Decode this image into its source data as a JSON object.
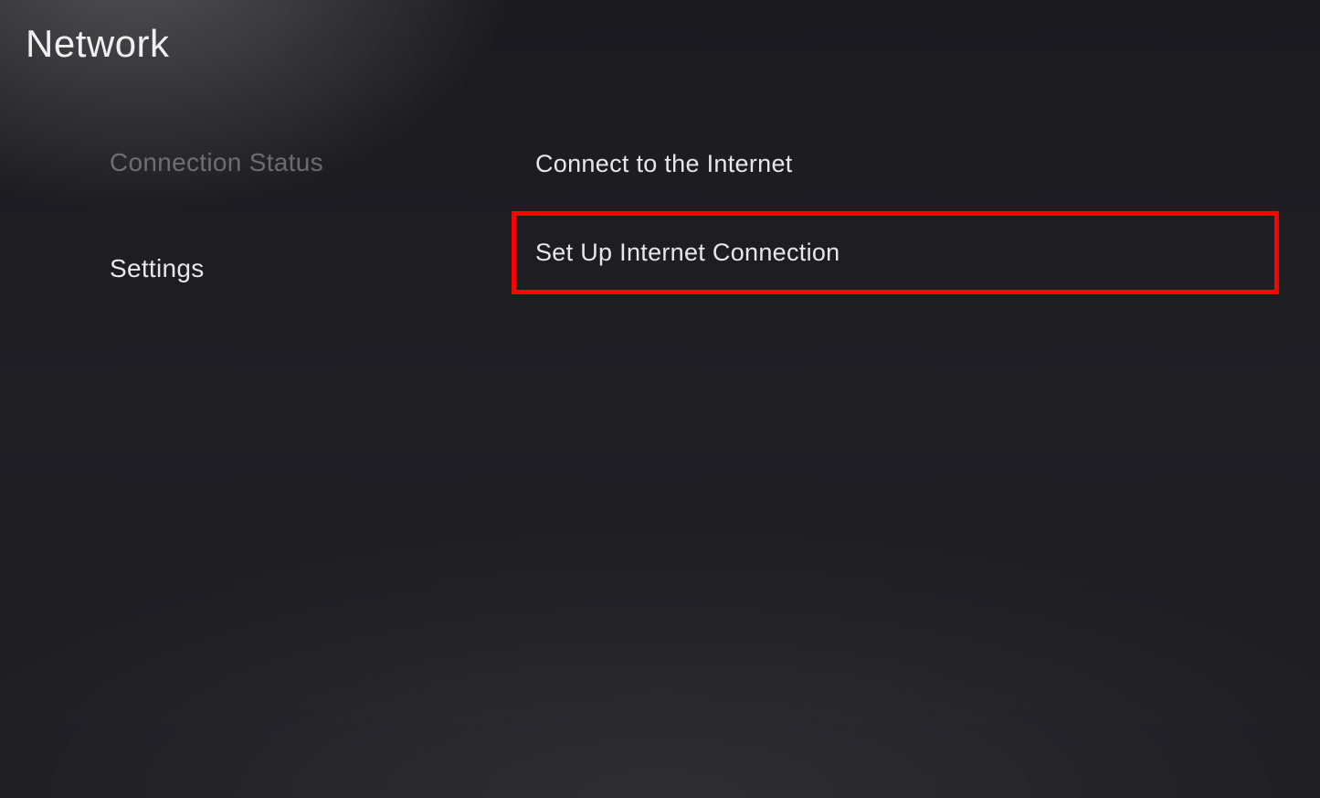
{
  "header": {
    "title": "Network"
  },
  "sidebar": {
    "items": [
      {
        "label": "Connection Status",
        "active": false
      },
      {
        "label": "Settings",
        "active": true
      }
    ]
  },
  "content": {
    "items": [
      {
        "label": "Connect to the Internet",
        "highlighted": false
      },
      {
        "label": "Set Up Internet Connection",
        "highlighted": true
      }
    ]
  }
}
